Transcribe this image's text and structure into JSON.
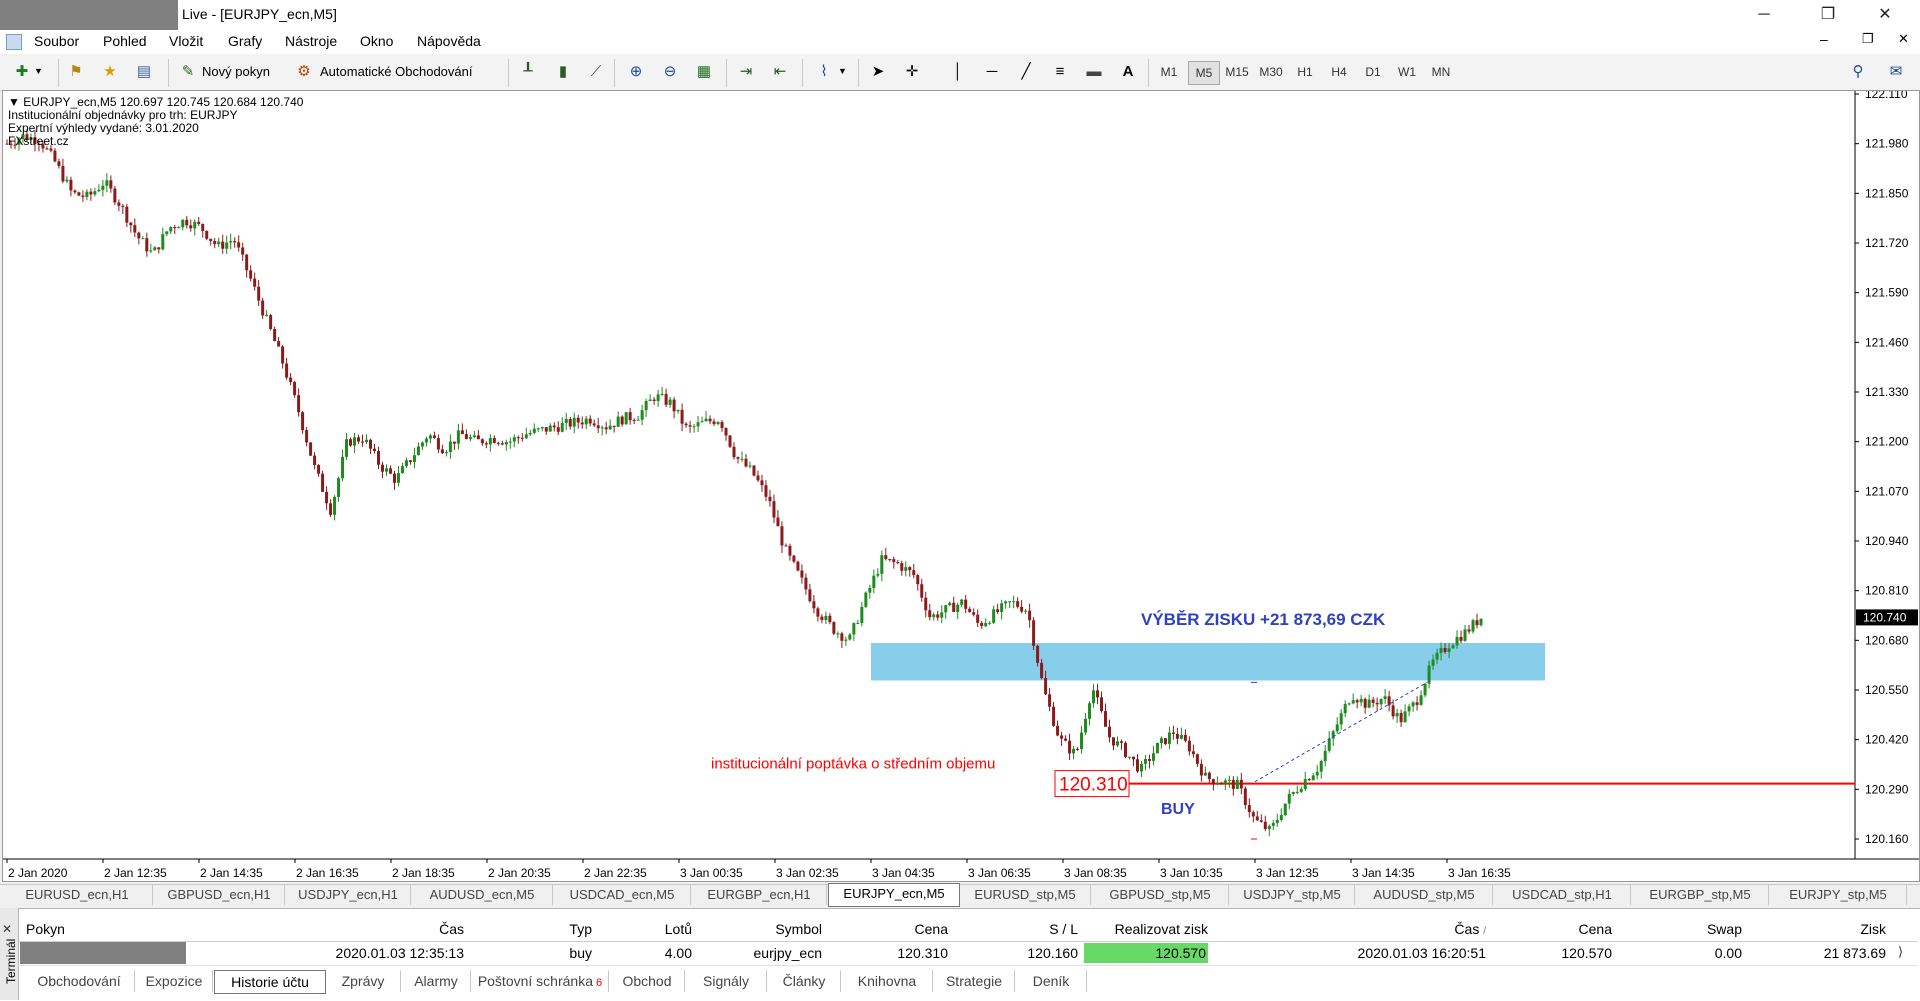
{
  "window": {
    "title": "Live - [EURJPY_ecn,M5]",
    "minimize_glyph": "─",
    "restore_glyph": "❐",
    "close_glyph": "✕",
    "mdi_minimize_glyph": "‒",
    "mdi_restore_glyph": "❐",
    "mdi_close_glyph": "✕"
  },
  "menu": [
    "Soubor",
    "Pohled",
    "Vložit",
    "Grafy",
    "Nástroje",
    "Okno",
    "Nápověda"
  ],
  "toolbar": {
    "new_order": "Nový pokyn",
    "auto_trading": "Automatické Obchodování",
    "timeframes": [
      "M1",
      "M5",
      "M15",
      "M30",
      "H1",
      "H4",
      "D1",
      "W1",
      "MN"
    ],
    "active_timeframe": "M5"
  },
  "chart": {
    "header_line": "EURJPY_ecn,M5  120.697 120.745 120.684 120.740",
    "info_lines": [
      "Institucionální objednávky pro trh: EURJPY",
      "Expertní výhledy vydané: 3.01.2020",
      "FXstreet.cz"
    ],
    "price_axis": [
      "122.110",
      "121.980",
      "121.850",
      "121.720",
      "121.590",
      "121.460",
      "121.330",
      "121.200",
      "121.070",
      "120.940",
      "120.810",
      "120.680",
      "120.550",
      "120.420",
      "120.290",
      "120.160"
    ],
    "current_price": "120.740",
    "time_axis": [
      "2 Jan 2020",
      "2 Jan 12:35",
      "2 Jan 14:35",
      "2 Jan 16:35",
      "2 Jan 18:35",
      "2 Jan 20:35",
      "2 Jan 22:35",
      "3 Jan 00:35",
      "3 Jan 02:35",
      "3 Jan 04:35",
      "3 Jan 06:35",
      "3 Jan 08:35",
      "3 Jan 10:35",
      "3 Jan 12:35",
      "3 Jan 14:35",
      "3 Jan 16:35"
    ],
    "profit_label": "VÝBĚR ZISKU +21 873,69 CZK",
    "demand_label": "institucionální poptávka o středním objemu",
    "entry_price": "120.310",
    "buy_label": "BUY",
    "colors": {
      "bull": "#1f8a1f",
      "bear": "#8b1a1a",
      "zone": "#87ceeb",
      "demand_line": "#ff0000",
      "annotation_blue": "#3040c0",
      "annotation_red": "#ff0000"
    },
    "price_path": [
      [
        0,
        121.98
      ],
      [
        2,
        122.0
      ],
      [
        4,
        121.99
      ],
      [
        6,
        121.93
      ],
      [
        8,
        121.85
      ],
      [
        10,
        121.84
      ],
      [
        12,
        121.88
      ],
      [
        14,
        121.82
      ],
      [
        16,
        121.74
      ],
      [
        18,
        121.69
      ],
      [
        20,
        121.76
      ],
      [
        22,
        121.78
      ],
      [
        24,
        121.76
      ],
      [
        26,
        121.71
      ],
      [
        28,
        121.73
      ],
      [
        30,
        121.63
      ],
      [
        32,
        121.52
      ],
      [
        34,
        121.41
      ],
      [
        36,
        121.28
      ],
      [
        38,
        121.13
      ],
      [
        40,
        121.02
      ],
      [
        42,
        121.2
      ],
      [
        44,
        121.21
      ],
      [
        46,
        121.14
      ],
      [
        48,
        121.1
      ],
      [
        50,
        121.16
      ],
      [
        52,
        121.22
      ],
      [
        54,
        121.18
      ],
      [
        56,
        121.22
      ],
      [
        58,
        121.2
      ],
      [
        60,
        121.21
      ],
      [
        62,
        121.2
      ],
      [
        64,
        121.22
      ],
      [
        66,
        121.23
      ],
      [
        68,
        121.24
      ],
      [
        70,
        121.25
      ],
      [
        72,
        121.26
      ],
      [
        74,
        121.24
      ],
      [
        76,
        121.26
      ],
      [
        78,
        121.27
      ],
      [
        80,
        121.32
      ],
      [
        82,
        121.3
      ],
      [
        84,
        121.23
      ],
      [
        86,
        121.25
      ],
      [
        88,
        121.26
      ],
      [
        90,
        121.16
      ],
      [
        92,
        121.12
      ],
      [
        94,
        121.05
      ],
      [
        96,
        120.92
      ],
      [
        98,
        120.84
      ],
      [
        100,
        120.76
      ],
      [
        102,
        120.71
      ],
      [
        104,
        120.68
      ],
      [
        106,
        120.79
      ],
      [
        108,
        120.89
      ],
      [
        110,
        120.88
      ],
      [
        112,
        120.85
      ],
      [
        114,
        120.74
      ],
      [
        116,
        120.76
      ],
      [
        118,
        120.78
      ],
      [
        120,
        120.72
      ],
      [
        122,
        120.75
      ],
      [
        124,
        120.78
      ],
      [
        126,
        120.76
      ],
      [
        128,
        120.55
      ],
      [
        130,
        120.42
      ],
      [
        132,
        120.38
      ],
      [
        134,
        120.56
      ],
      [
        136,
        120.43
      ],
      [
        138,
        120.39
      ],
      [
        140,
        120.34
      ],
      [
        142,
        120.4
      ],
      [
        144,
        120.44
      ],
      [
        146,
        120.4
      ],
      [
        148,
        120.32
      ],
      [
        150,
        120.31
      ],
      [
        152,
        120.3
      ],
      [
        154,
        120.21
      ],
      [
        156,
        120.18
      ],
      [
        158,
        120.26
      ],
      [
        160,
        120.31
      ],
      [
        162,
        120.35
      ],
      [
        164,
        120.45
      ],
      [
        166,
        120.54
      ],
      [
        168,
        120.51
      ],
      [
        170,
        120.53
      ],
      [
        172,
        120.47
      ],
      [
        174,
        120.52
      ],
      [
        176,
        120.62
      ],
      [
        178,
        120.67
      ],
      [
        180,
        120.7
      ],
      [
        182,
        120.74
      ]
    ]
  },
  "chart_tabs": [
    "EURUSD_ecn,H1",
    "GBPUSD_ecn,H1",
    "USDJPY_ecn,H1",
    "AUDUSD_ecn,M5",
    "USDCAD_ecn,M5",
    "EURGBP_ecn,H1",
    "EURJPY_ecn,M5",
    "EURUSD_stp,M5",
    "GBPUSD_stp,M5",
    "USDJPY_stp,M5",
    "AUDUSD_stp,M5",
    "USDCAD_stp,H1",
    "EURGBP_stp,M5",
    "EURJPY_stp,M5"
  ],
  "active_chart_tab": "EURJPY_ecn,M5",
  "terminal": {
    "side_label": "Terminál",
    "columns": [
      "Pokyn",
      "Čas",
      "Typ",
      "Lotů",
      "Symbol",
      "Cena",
      "S / L",
      "Realizovat zisk",
      "Čas",
      "Cena",
      "Swap",
      "Zisk"
    ],
    "sort_indicator": "/",
    "row": {
      "order": "",
      "open_time": "2020.01.03 12:35:13",
      "type": "buy",
      "lots": "4.00",
      "symbol": "eurjpy_ecn",
      "open_price": "120.310",
      "sl": "120.160",
      "tp": "120.570",
      "close_time": "2020.01.03 16:20:51",
      "close_price": "120.570",
      "swap": "0.00",
      "profit": "21 873.69"
    },
    "tabs": [
      "Obchodování",
      "Expozice",
      "Historie účtu",
      "Zprávy",
      "Alarmy",
      "Poštovní schránka",
      "Obchod",
      "Signály",
      "Články",
      "Knihovna",
      "Strategie",
      "Deník"
    ],
    "mailbox_count": "6",
    "active_tab": "Historie účtu"
  }
}
